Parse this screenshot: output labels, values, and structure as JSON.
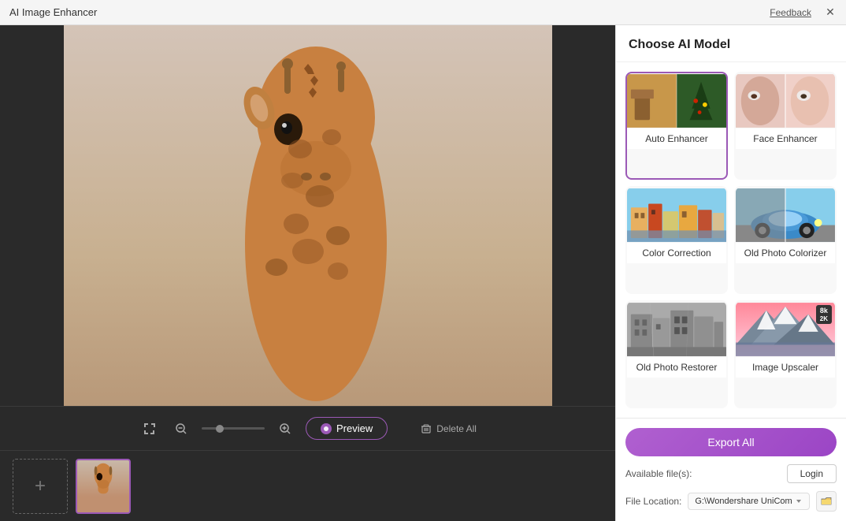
{
  "titleBar": {
    "title": "AI Image Enhancer",
    "feedback": "Feedback",
    "close": "✕"
  },
  "rightPanel": {
    "chooseModelLabel": "Choose AI Model",
    "models": [
      {
        "id": "auto-enhancer",
        "label": "Auto Enhancer",
        "active": true,
        "badge": null
      },
      {
        "id": "face-enhancer",
        "label": "Face Enhancer",
        "active": false,
        "badge": null
      },
      {
        "id": "color-correction",
        "label": "Color Correction",
        "active": false,
        "badge": null
      },
      {
        "id": "old-photo-colorizer",
        "label": "Old Photo Colorizer",
        "active": false,
        "badge": null
      },
      {
        "id": "old-photo-restorer",
        "label": "Old Photo Restorer",
        "active": false,
        "badge": null
      },
      {
        "id": "image-upscaler",
        "label": "Image Upscaler",
        "active": false,
        "badge": "8k"
      }
    ],
    "exportAllLabel": "Export All",
    "availableFilesLabel": "Available file(s):",
    "loginLabel": "Login",
    "fileLocationLabel": "File Location:",
    "fileLocationPath": "G:\\Wondershare UniCom",
    "browseIcon": "📁"
  },
  "toolbar": {
    "previewLabel": "Preview",
    "deleteAllLabel": "Delete All",
    "previewIcon": "◉"
  },
  "thumbnails": {
    "addIcon": "+"
  }
}
